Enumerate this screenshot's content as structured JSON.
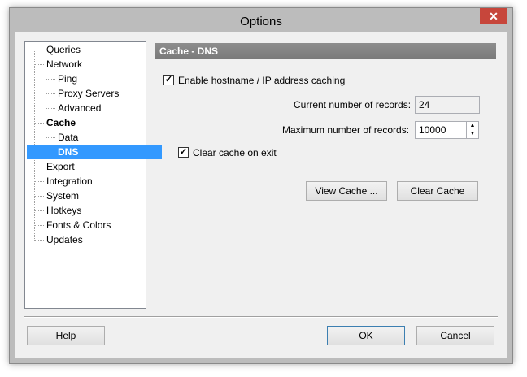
{
  "window": {
    "title": "Options",
    "close_label": "✕"
  },
  "tree": {
    "items": [
      {
        "label": "Queries",
        "bold": false,
        "selected": false
      },
      {
        "label": "Network",
        "bold": false,
        "selected": false
      },
      {
        "label": "Ping",
        "bold": false,
        "selected": false
      },
      {
        "label": "Proxy Servers",
        "bold": false,
        "selected": false
      },
      {
        "label": "Advanced",
        "bold": false,
        "selected": false
      },
      {
        "label": "Cache",
        "bold": true,
        "selected": false
      },
      {
        "label": "Data",
        "bold": false,
        "selected": false
      },
      {
        "label": "DNS",
        "bold": true,
        "selected": true
      },
      {
        "label": "Export",
        "bold": false,
        "selected": false
      },
      {
        "label": "Integration",
        "bold": false,
        "selected": false
      },
      {
        "label": "System",
        "bold": false,
        "selected": false
      },
      {
        "label": "Hotkeys",
        "bold": false,
        "selected": false
      },
      {
        "label": "Fonts & Colors",
        "bold": false,
        "selected": false
      },
      {
        "label": "Updates",
        "bold": false,
        "selected": false
      }
    ]
  },
  "panel": {
    "header": "Cache - DNS",
    "enable_caching": {
      "label": "Enable hostname / IP address caching",
      "checked": true
    },
    "current_records": {
      "label": "Current number of records:",
      "value": "24"
    },
    "max_records": {
      "label": "Maximum number of records:",
      "value": "10000"
    },
    "clear_on_exit": {
      "label": "Clear cache on exit",
      "checked": true
    },
    "view_cache_label": "View Cache ...",
    "clear_cache_label": "Clear Cache"
  },
  "footer": {
    "help_label": "Help",
    "ok_label": "OK",
    "cancel_label": "Cancel"
  }
}
